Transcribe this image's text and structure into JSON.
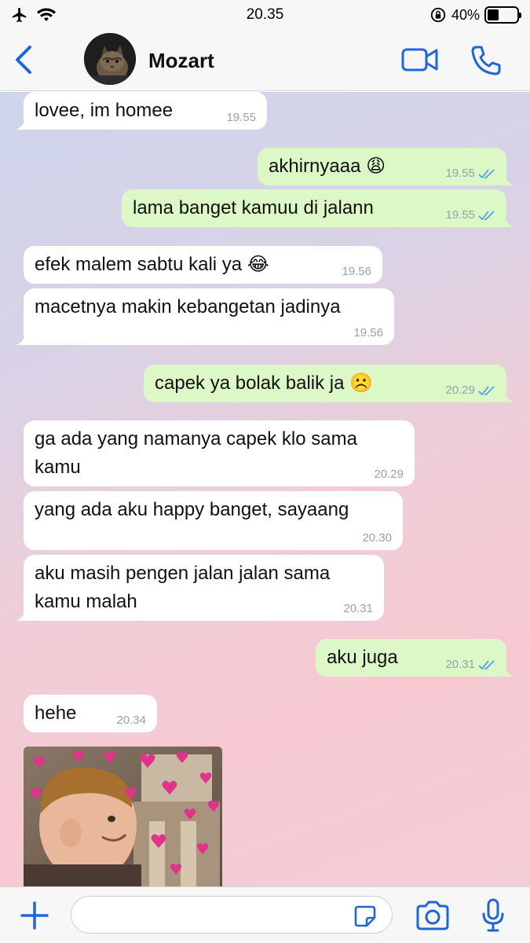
{
  "status_bar": {
    "time": "20.35",
    "battery_text": "40%",
    "battery_level": 0.4
  },
  "header": {
    "contact_name": "Mozart"
  },
  "messages": [
    {
      "dir": "in",
      "text": "lovee, im homee",
      "time": "19.55"
    },
    {
      "dir": "out",
      "text": "akhirnyaaa 😩",
      "time": "19.55",
      "read": true
    },
    {
      "dir": "out",
      "text": "lama banget kamuu di jalann",
      "time": "19.55",
      "read": true
    },
    {
      "dir": "in",
      "text": "efek malem sabtu kali ya 😂",
      "time": "19.56"
    },
    {
      "dir": "in",
      "text": "macetnya makin kebangetan jadinya",
      "time": "19.56"
    },
    {
      "dir": "out",
      "text": "capek ya bolak balik ja ☹️",
      "time": "20.29",
      "read": true
    },
    {
      "dir": "in",
      "text": "ga ada yang namanya capek klo sama",
      "text2": "kamu",
      "time": "20.29"
    },
    {
      "dir": "in",
      "text": "yang ada aku happy banget, sayaang",
      "time": "20.30"
    },
    {
      "dir": "in",
      "text": "aku masih pengen jalan jalan sama",
      "text2": "kamu malah",
      "time": "20.31"
    },
    {
      "dir": "out",
      "text": "aku juga",
      "time": "20.31",
      "read": true
    },
    {
      "dir": "in",
      "text": "hehe",
      "time": "20.34"
    }
  ],
  "input": {
    "placeholder": ""
  },
  "colors": {
    "accent": "#1f66d6",
    "incoming_bubble": "#ffffff",
    "outgoing_bubble": "#dcf8c6",
    "read_ticks": "#4fa3e0"
  }
}
